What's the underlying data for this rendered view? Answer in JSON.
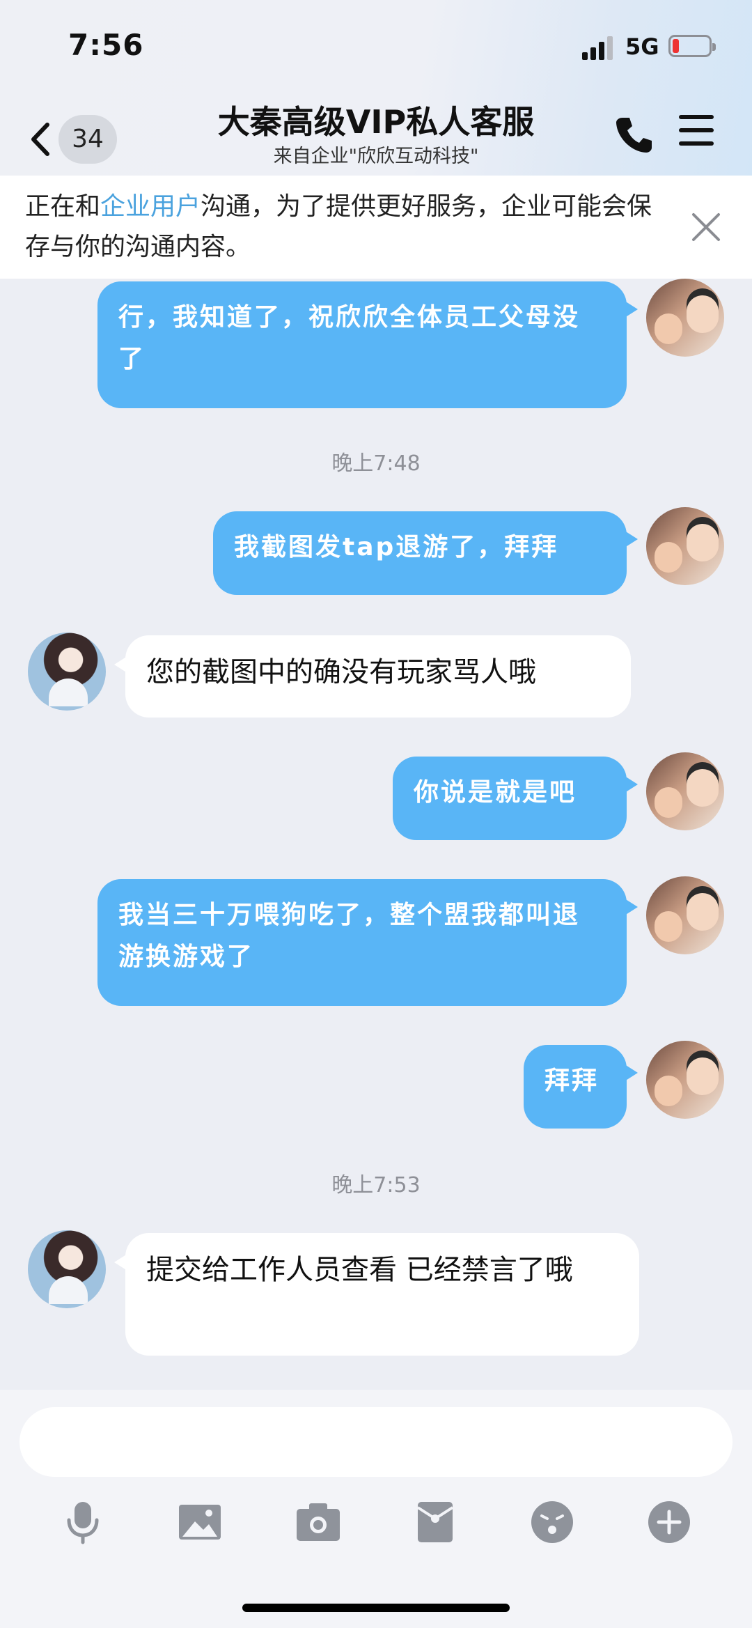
{
  "status_bar": {
    "time": "7:56",
    "network": "5G",
    "battery_level": 0.12,
    "signal_bars": 3
  },
  "nav": {
    "back_count": "34",
    "title": "大秦高级VIP私人客服",
    "subtitle": "来自企业\"欣欣互动科技\"",
    "icons": [
      "chevron-left-icon",
      "phone-icon",
      "menu-icon"
    ]
  },
  "notice": {
    "text_before": "正在和",
    "link": "企业用户",
    "text_after": "沟通，为了提供更好服务，企业可能会保存与你的沟通内容。"
  },
  "messages": [
    {
      "sender": "me",
      "text": "行，我知道了，祝欣欣全体员工父母没了"
    },
    {
      "type": "time",
      "text": "晚上7:48"
    },
    {
      "sender": "me",
      "text": "我截图发tap退游了，拜拜"
    },
    {
      "sender": "them",
      "text": "您的截图中的确没有玩家骂人哦"
    },
    {
      "sender": "me",
      "text": "你说是就是吧"
    },
    {
      "sender": "me",
      "text": "我当三十万喂狗吃了，整个盟我都叫退游换游戏了"
    },
    {
      "sender": "me",
      "text": "拜拜"
    },
    {
      "type": "time",
      "text": "晚上7:53"
    },
    {
      "sender": "them",
      "text": "提交给工作人员查看 已经禁言了哦"
    }
  ],
  "input": {
    "value": "",
    "placeholder": ""
  },
  "toolbar": {
    "icons": [
      "microphone-icon",
      "image-icon",
      "camera-icon",
      "red-packet-icon",
      "emoji-icon",
      "plus-icon"
    ]
  },
  "colors": {
    "my_bubble": "#59b5f6",
    "their_bubble": "#ffffff",
    "link": "#4aa2de",
    "background": "#eceef4"
  }
}
